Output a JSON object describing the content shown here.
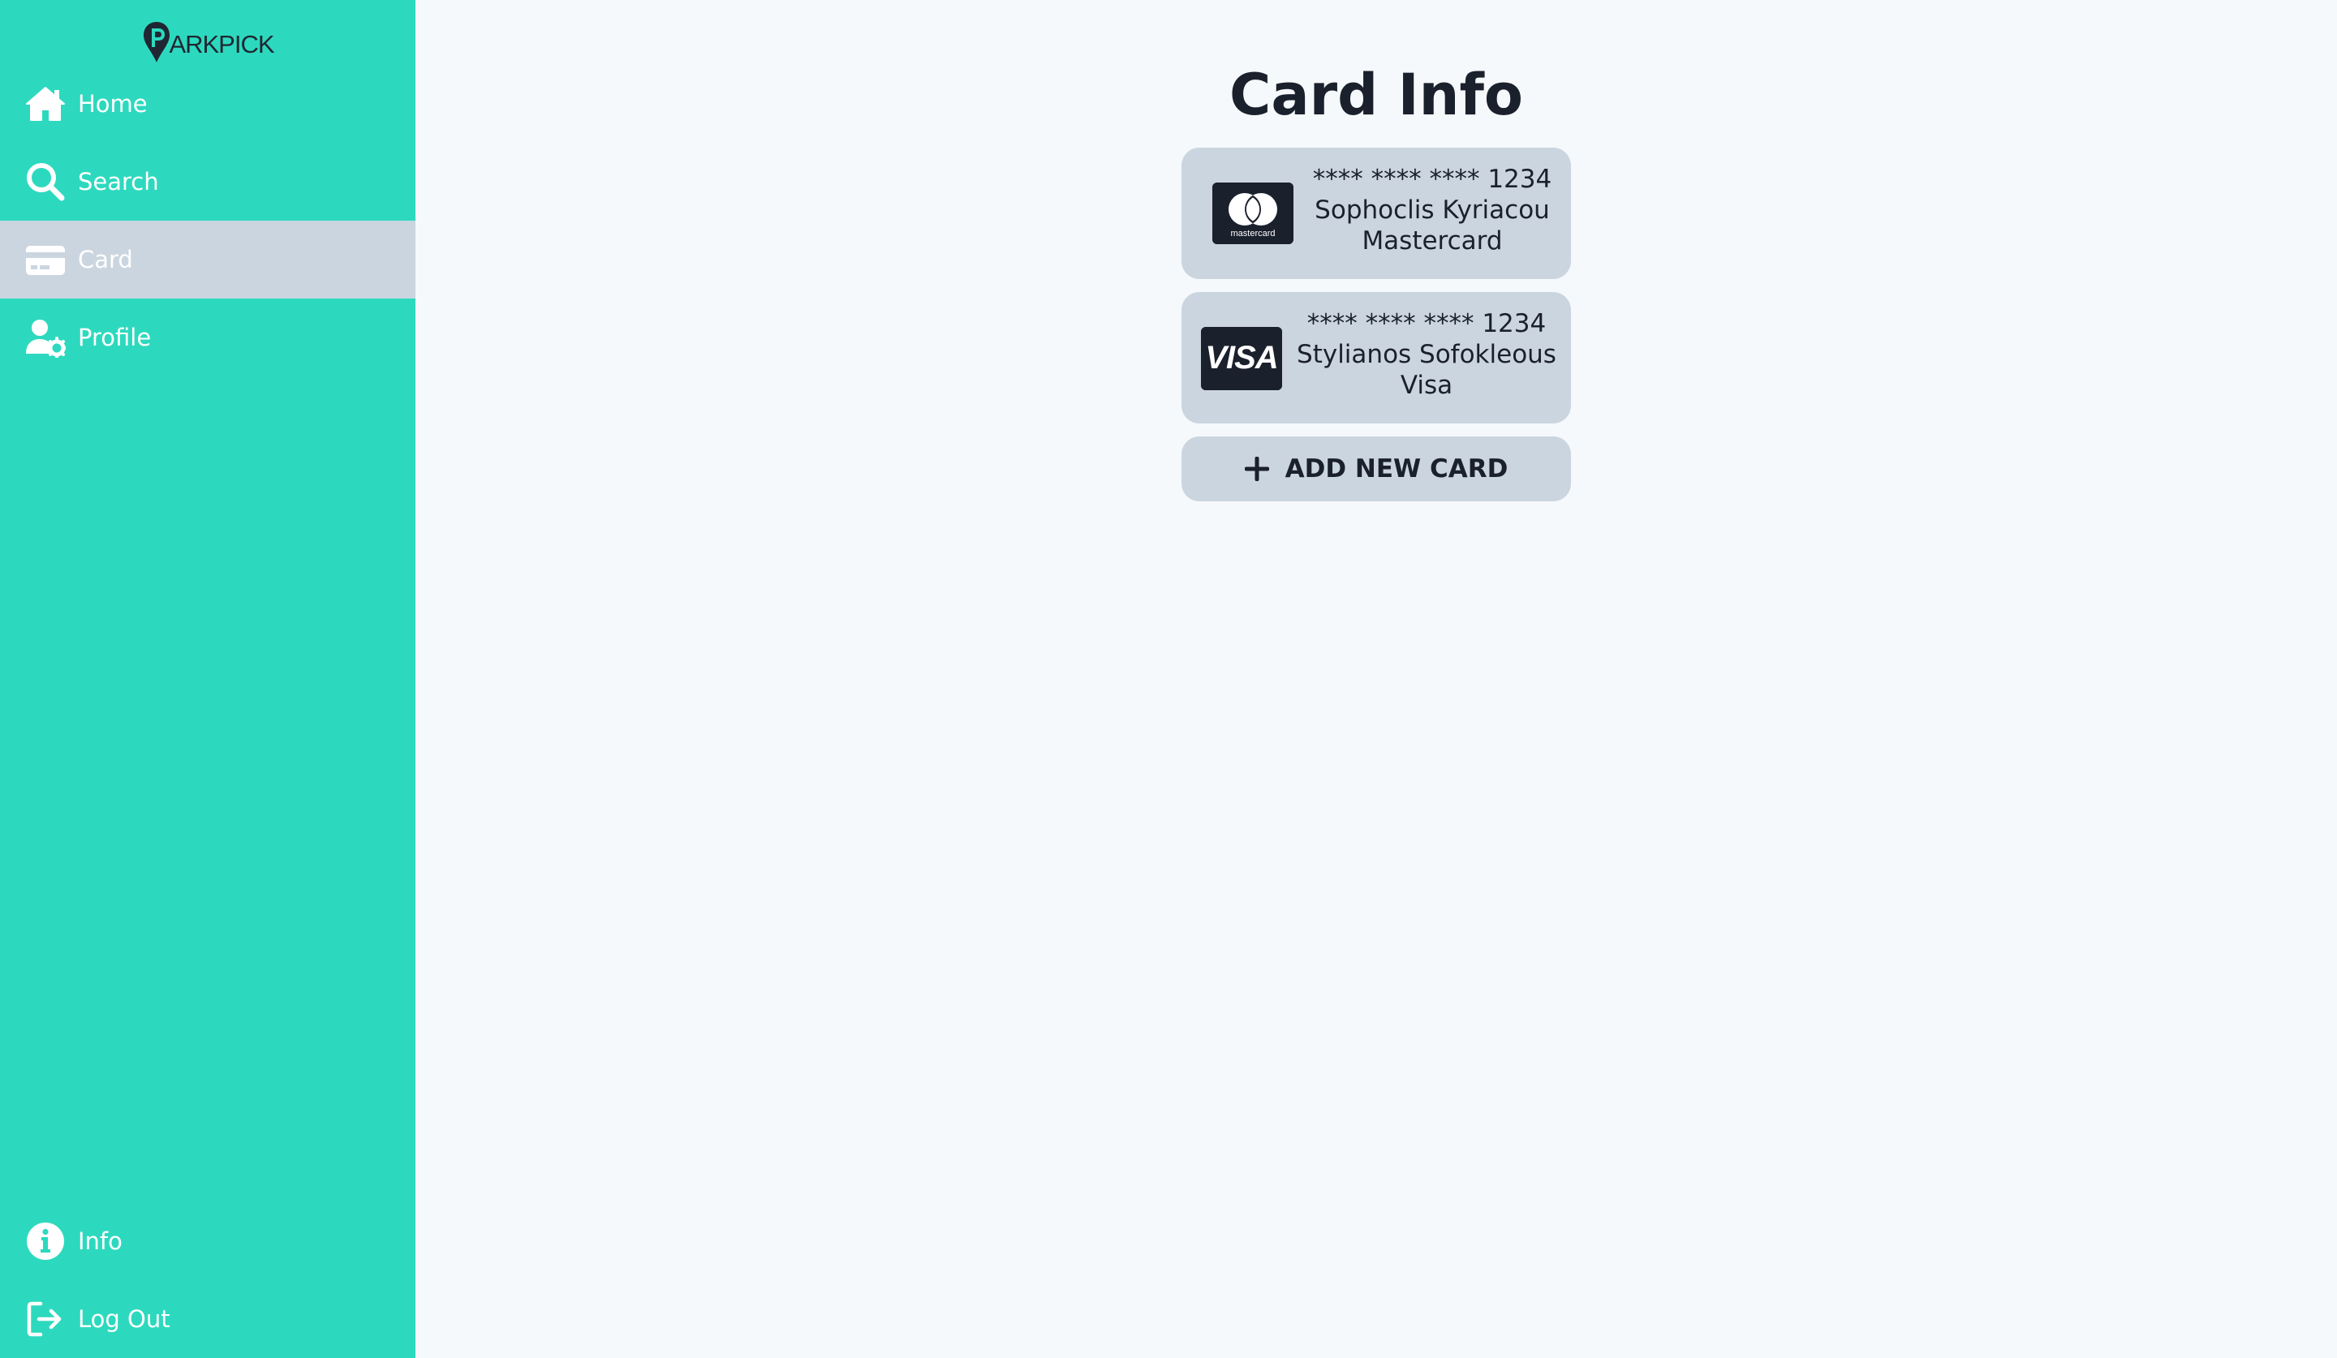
{
  "app": {
    "logo_text": "ARKPICK"
  },
  "sidebar": {
    "items": [
      {
        "label": "Home",
        "icon": "home-icon"
      },
      {
        "label": "Search",
        "icon": "search-icon"
      },
      {
        "label": "Card",
        "icon": "credit-card-icon",
        "active": true
      },
      {
        "label": "Profile",
        "icon": "user-gear-icon"
      }
    ],
    "bottom_items": [
      {
        "label": "Info",
        "icon": "info-icon"
      },
      {
        "label": "Log Out",
        "icon": "logout-icon"
      }
    ]
  },
  "main": {
    "title": "Card Info",
    "cards": [
      {
        "number": "**** **** **** 1234",
        "holder": "Sophoclis Kyriacou",
        "type": "Mastercard",
        "brand_logo": "mastercard-logo",
        "brand_logo_text": "mastercard"
      },
      {
        "number": "**** **** **** 1234",
        "holder": "Stylianos Sofokleous",
        "type": "Visa",
        "brand_logo": "visa-logo",
        "brand_logo_text": "VISA"
      }
    ],
    "add_card_label": "ADD NEW CARD"
  },
  "colors": {
    "sidebar_bg": "#2dd9be",
    "active_item_bg": "#cbd5e0",
    "card_bg": "#cbd5e0",
    "page_bg": "#f5f9fb",
    "text_dark": "#1a202c"
  }
}
